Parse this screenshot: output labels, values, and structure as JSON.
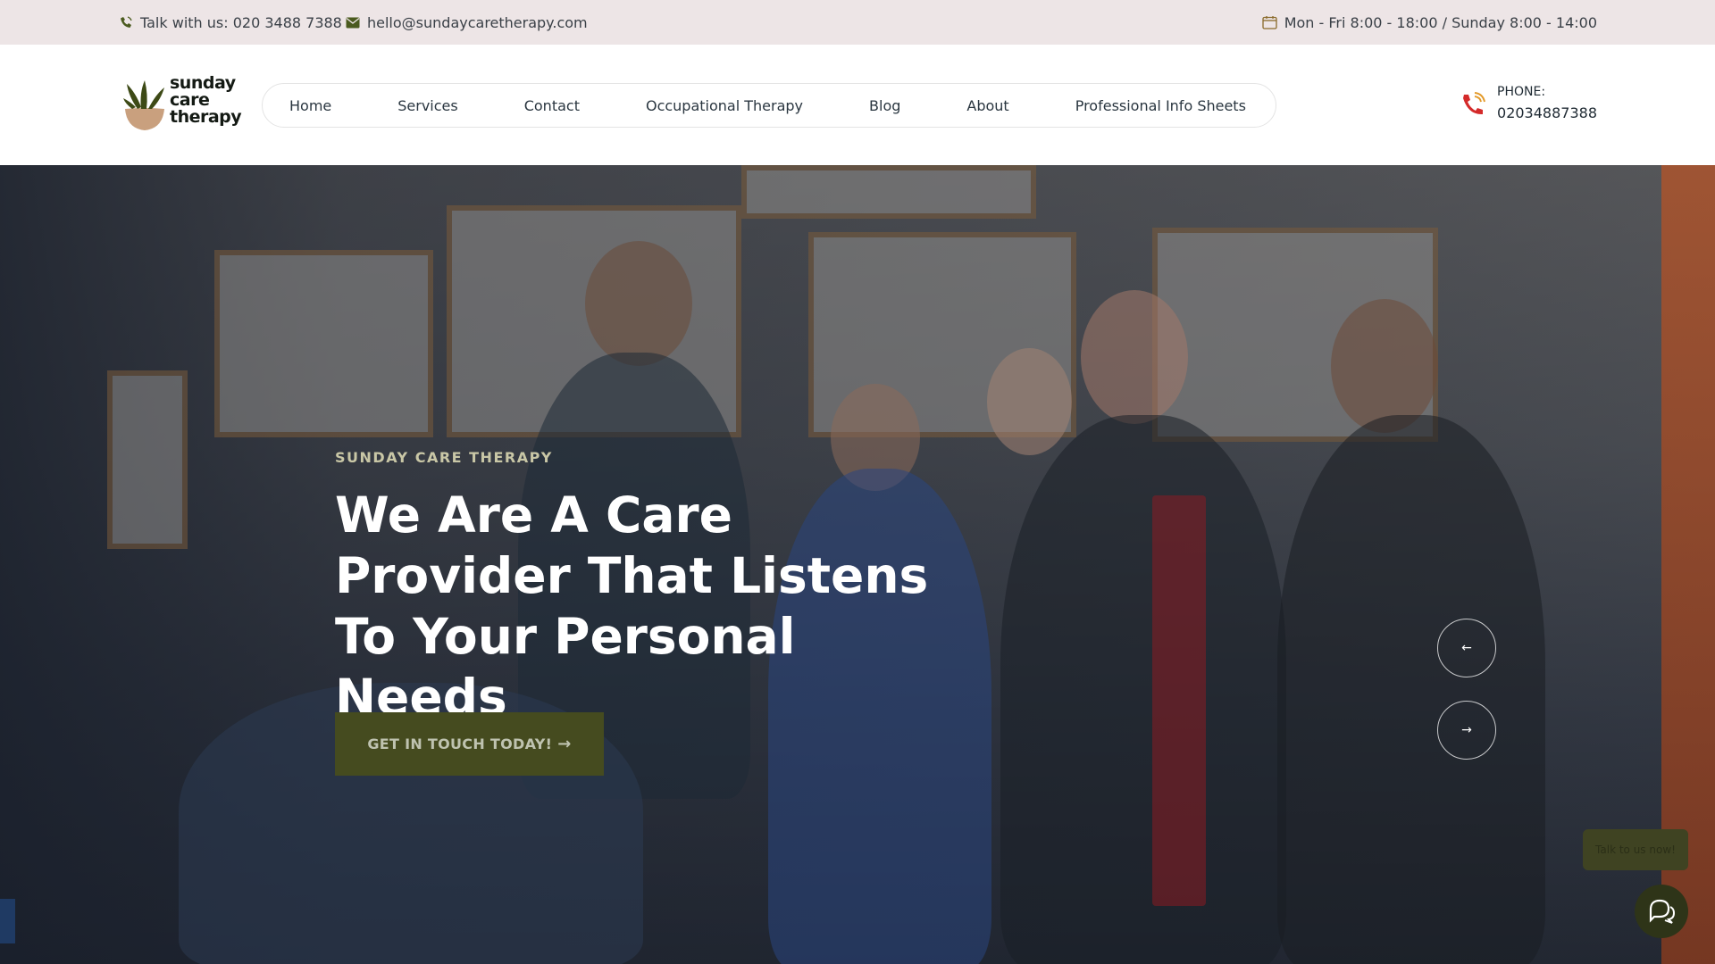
{
  "topbar": {
    "phone_text": "Talk with us: 020 3488 7388",
    "email_text": "hello@sundaycaretherapy.com",
    "hours_text": "Mon - Fri 8:00 - 18:00 / Sunday 8:00 - 14:00",
    "phone_icon": "phone-ring-icon",
    "email_icon": "envelope-icon",
    "hours_icon": "calendar-icon"
  },
  "header": {
    "logo_lines": [
      "sunday",
      "care",
      "therapy"
    ],
    "nav": [
      {
        "label": "Home"
      },
      {
        "label": "Services"
      },
      {
        "label": "Contact"
      },
      {
        "label": "Occupational Therapy"
      },
      {
        "label": "Blog"
      },
      {
        "label": "About"
      },
      {
        "label": "Professional Info Sheets"
      }
    ],
    "phone_label": "PHONE:",
    "phone_number": "02034887388"
  },
  "hero": {
    "tagline": "SUNDAY CARE THERAPY",
    "title": "We Are A Care Provider That Listens To Your Personal Needs",
    "cta_label": "GET IN TOUCH TODAY!",
    "prev_icon": "arrow-left-icon",
    "next_icon": "arrow-right-icon"
  },
  "chat": {
    "bubble_text": "Talk to us now!",
    "icon": "chat-icon"
  },
  "colors": {
    "topbar_bg": "#ede5e6",
    "brand_green": "#454b1f",
    "logo_clay": "#c9a07e",
    "phone_red": "#d42a2a"
  }
}
